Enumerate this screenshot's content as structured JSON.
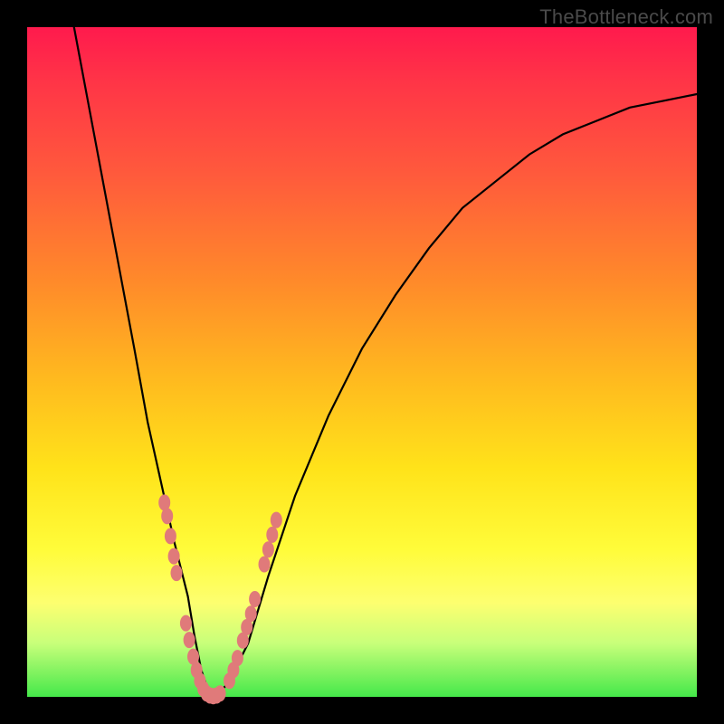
{
  "watermark": "TheBottleneck.com",
  "colors": {
    "frame": "#000000",
    "gradient_top": "#ff1a4d",
    "gradient_mid1": "#ff8a2a",
    "gradient_mid2": "#ffe31a",
    "gradient_bottom": "#45e84a",
    "curve": "#000000",
    "marker": "#e07a7a"
  },
  "chart_data": {
    "type": "line",
    "title": "",
    "xlabel": "",
    "ylabel": "",
    "xlim": [
      0,
      100
    ],
    "ylim": [
      0,
      100
    ],
    "grid": false,
    "legend": false,
    "series": [
      {
        "name": "bottleneck-curve",
        "x": [
          7,
          10,
          13,
          16,
          18,
          20,
          22,
          24,
          25,
          26,
          27,
          28,
          30,
          33,
          36,
          40,
          45,
          50,
          55,
          60,
          65,
          70,
          75,
          80,
          85,
          90,
          95,
          100
        ],
        "y": [
          100,
          84,
          68,
          52,
          41,
          32,
          23,
          15,
          9,
          4,
          1,
          0,
          2,
          8,
          18,
          30,
          42,
          52,
          60,
          67,
          73,
          77,
          81,
          84,
          86,
          88,
          89,
          90
        ]
      }
    ],
    "markers": {
      "name": "highlighted-points",
      "points_xy": [
        [
          20.5,
          29
        ],
        [
          20.9,
          27
        ],
        [
          21.4,
          24
        ],
        [
          21.9,
          21
        ],
        [
          22.3,
          18.5
        ],
        [
          23.7,
          11
        ],
        [
          24.2,
          8.5
        ],
        [
          24.8,
          6
        ],
        [
          25.3,
          4
        ],
        [
          25.8,
          2.4
        ],
        [
          26.3,
          1.2
        ],
        [
          26.8,
          0.5
        ],
        [
          27.3,
          0.2
        ],
        [
          27.8,
          0.1
        ],
        [
          28.3,
          0.2
        ],
        [
          28.8,
          0.5
        ],
        [
          30.2,
          2.4
        ],
        [
          30.8,
          4
        ],
        [
          31.4,
          5.8
        ],
        [
          32.2,
          8.4
        ],
        [
          32.8,
          10.4
        ],
        [
          33.4,
          12.4
        ],
        [
          34.0,
          14.6
        ],
        [
          35.4,
          19.8
        ],
        [
          36.0,
          22
        ],
        [
          36.6,
          24.2
        ],
        [
          37.2,
          26.4
        ]
      ]
    }
  }
}
